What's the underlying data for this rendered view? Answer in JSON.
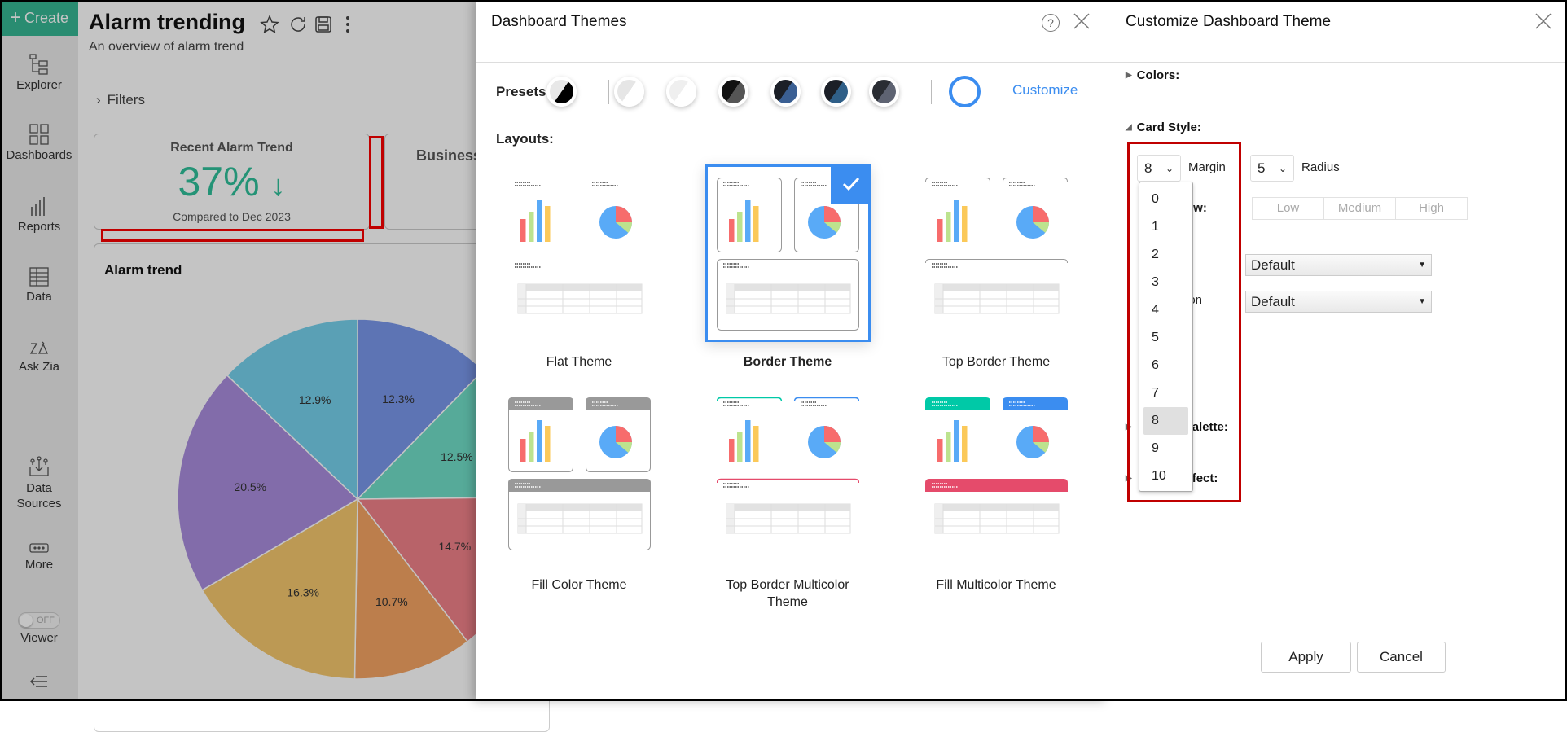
{
  "sidebar": {
    "create_label": "Create",
    "items": [
      {
        "label": "Explorer",
        "icon": "explorer-icon"
      },
      {
        "label": "Dashboards",
        "icon": "dashboards-icon"
      },
      {
        "label": "Reports",
        "icon": "reports-icon"
      },
      {
        "label": "Data",
        "icon": "data-table-icon"
      },
      {
        "label": "Ask Zia",
        "icon": "zia-icon"
      },
      {
        "label": "Data Sources",
        "icon": "data-sources-icon"
      },
      {
        "label": "More",
        "icon": "more-icon"
      }
    ],
    "viewer_toggle": {
      "state": "OFF",
      "label": "Viewer"
    },
    "collapse_icon": "collapse-menu-icon"
  },
  "dashboard": {
    "title": "Alarm trending",
    "subtitle": "An overview of alarm trend",
    "filters_label": "Filters",
    "kpi": {
      "title": "Recent Alarm Trend",
      "value": "37%",
      "arrow": "↓",
      "comparison": "Compared to Dec 2023",
      "value_color": "#30c09a"
    },
    "business_card_title": "Business",
    "chart_title": "Alarm trend"
  },
  "chart_data": {
    "type": "pie",
    "title": "Alarm trend",
    "values": [
      12.3,
      12.5,
      14.7,
      10.7,
      16.3,
      20.5,
      12.9
    ],
    "labels": [
      "12.3%",
      "12.5%",
      "14.7%",
      "10.7%",
      "16.3%",
      "20.5%",
      "12.9%"
    ],
    "colors": [
      "#7997eb",
      "#71dec8",
      "#f08189",
      "#f5a563",
      "#f5c86e",
      "#a98ddd",
      "#76d0ec"
    ]
  },
  "themes_panel": {
    "title": "Dashboard Themes",
    "presets_label": "Presets:",
    "presets": [
      {
        "a": "#e8e8e8",
        "b": "#000000"
      },
      {
        "a": "#e6e6e6",
        "b": "#ffffff"
      },
      {
        "a": "#efefef",
        "b": "#ffffff"
      },
      {
        "a": "#111111",
        "b": "#555555"
      },
      {
        "a": "#1b1f27",
        "b": "#3a5f93"
      },
      {
        "a": "#1b1f27",
        "b": "#2f5f88"
      },
      {
        "a": "#2a2d33",
        "b": "#5e6372"
      }
    ],
    "customize_label": "Customize",
    "accent": "#3b8df0",
    "layouts_label": "Layouts:",
    "layouts": [
      {
        "label": "Flat Theme",
        "variant": "flat",
        "selected": false
      },
      {
        "label": "Border Theme",
        "variant": "border",
        "selected": true
      },
      {
        "label": "Top Border Theme",
        "variant": "topborder",
        "selected": false
      },
      {
        "label": "Fill Color Theme",
        "variant": "fill",
        "selected": false
      },
      {
        "label": "Top Border Multicolor Theme",
        "variant": "topmulti",
        "selected": false
      },
      {
        "label": "Fill Multicolor Theme",
        "variant": "fillmulti",
        "selected": false
      }
    ]
  },
  "customize_panel": {
    "title": "Customize Dashboard Theme",
    "colors_label": "Colors:",
    "card_style_label": "Card Style:",
    "margin": {
      "value": "8",
      "label": "Margin",
      "options": [
        "0",
        "1",
        "2",
        "3",
        "4",
        "5",
        "6",
        "7",
        "8",
        "9",
        "10"
      ]
    },
    "radius": {
      "value": "5",
      "label": "Radius"
    },
    "shadow_label_fragment": "ow:",
    "shadow_options": [
      "Low",
      "Medium",
      "High"
    ],
    "select1_value": "Default",
    "select2_label_fragment": "ion",
    "select2_value": "Default",
    "palette_label_fragment": "alette:",
    "effect_label_fragment": "fect:",
    "apply_label": "Apply",
    "cancel_label": "Cancel"
  }
}
